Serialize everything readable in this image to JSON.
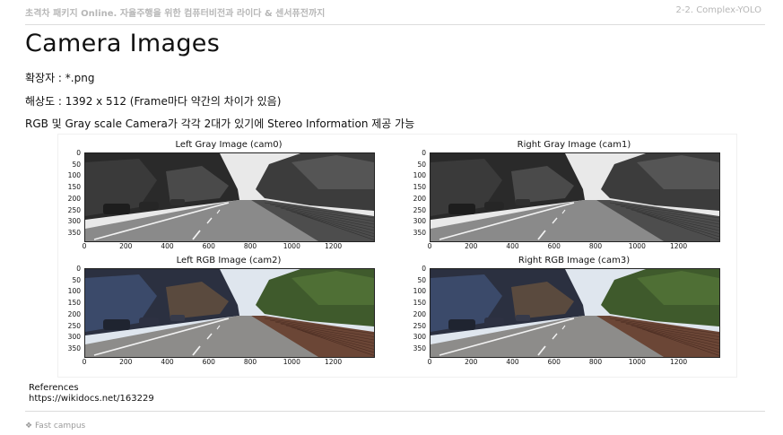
{
  "header": {
    "left": "초격차 패키지 Online. 자율주행을 위한 컴퓨터비전과 라이다 & 센서퓨전까지",
    "right": "2-2. Complex-YOLO"
  },
  "title": "Camera Images",
  "lines": [
    "확장자 : *.png",
    "해상도 : 1392 x 512 (Frame마다 약간의 차이가 있음)",
    "RGB 및 Gray scale Camera가 각각 2대가 있기에 Stereo Information 제공 가능"
  ],
  "panels": [
    {
      "title": "Left Gray Image (cam0)",
      "mode": "gray"
    },
    {
      "title": "Right Gray Image (cam1)",
      "mode": "gray"
    },
    {
      "title": "Left RGB Image (cam2)",
      "mode": "rgb"
    },
    {
      "title": "Right RGB Image (cam3)",
      "mode": "rgb"
    }
  ],
  "y_ticks": [
    "0",
    "50",
    "100",
    "150",
    "200",
    "250",
    "300",
    "350"
  ],
  "x_ticks": [
    "0",
    "200",
    "400",
    "600",
    "800",
    "1000",
    "1200"
  ],
  "references": {
    "label": "References",
    "url": "https://wikidocs.net/163229"
  },
  "footer": "Fast campus"
}
